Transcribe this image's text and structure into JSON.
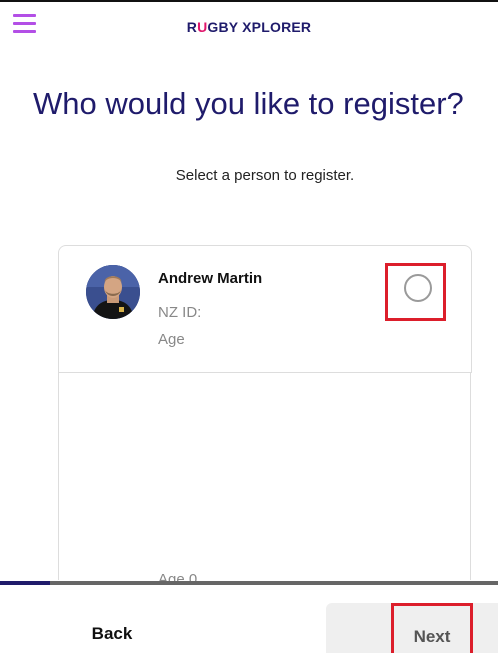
{
  "header": {
    "logo_prefix": "R",
    "logo_accent": "U",
    "logo_suffix": "GBY XPLORER",
    "menu_icon": "hamburger-menu-icon"
  },
  "main": {
    "title": "Who would you like to register?",
    "instruction": "Select a person to register.",
    "people": [
      {
        "name": "Andrew Martin",
        "nz_id_label": "NZ ID:",
        "age_label": "Age",
        "selected": false
      }
    ],
    "next_item_age_partial": "Age 0"
  },
  "progress": {
    "fraction": 0.1
  },
  "footer": {
    "back_label": "Back",
    "next_label": "Next"
  },
  "colors": {
    "brand_navy": "#1f1b6b",
    "brand_pink": "#e0156b",
    "menu_purple": "#b34fe6",
    "highlight_red": "#dc1e2b"
  }
}
